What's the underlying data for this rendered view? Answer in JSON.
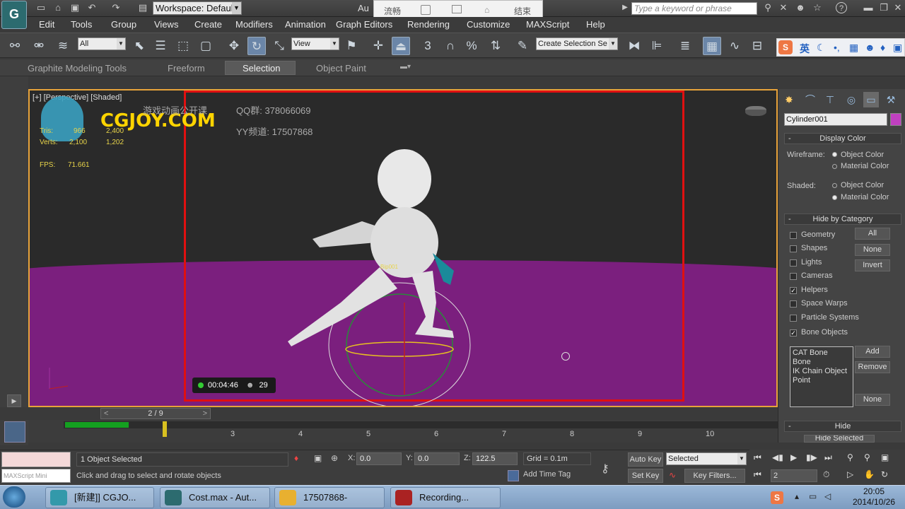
{
  "titlebar": {
    "workspace_label": "Workspace: Default",
    "app_title": "Au",
    "overlay_items": [
      "流畅",
      "结束"
    ],
    "search_placeholder": "Type a keyword or phrase"
  },
  "menu": [
    "Edit",
    "Tools",
    "Group",
    "Views",
    "Create",
    "Modifiers",
    "Animation",
    "Graph Editors",
    "Rendering",
    "Customize",
    "MAXScript",
    "Help"
  ],
  "toolbar": {
    "filter_select": "All",
    "refcoord_select": "View",
    "selection_set": "Create Selection Se",
    "snap_labels": [
      "3",
      "%"
    ]
  },
  "ime": {
    "lang": "英"
  },
  "ribbon": {
    "tabs": [
      "Graphite Modeling Tools",
      "Freeform",
      "Selection",
      "Object Paint"
    ]
  },
  "viewport": {
    "label": "[+] [Perspective] [Shaded]",
    "stats": {
      "tris_label": "Tris:",
      "tris_total": "966",
      "tris_sel": "2,400",
      "verts_label": "Verts:",
      "verts_total": "2,100",
      "verts_sel": "1,202",
      "fps_label": "FPS:",
      "fps": "71.661"
    },
    "watermark": {
      "brand": "CGJOY.COM",
      "subtitle": "游戏动画公开课",
      "qq": "QQ群:  378066069",
      "yy": "YY频道: 17507868"
    },
    "timer": {
      "time": "00:04:46",
      "viewers": "29"
    }
  },
  "cmdpanel": {
    "object_name": "Cylinder001",
    "object_color": "#c040c0",
    "display_color": {
      "title": "Display Color",
      "wireframe_label": "Wireframe:",
      "shaded_label": "Shaded:",
      "opt_object": "Object Color",
      "opt_material": "Material Color"
    },
    "hide_by_category": {
      "title": "Hide by Category",
      "items": [
        {
          "label": "Geometry",
          "checked": false
        },
        {
          "label": "Shapes",
          "checked": false
        },
        {
          "label": "Lights",
          "checked": false
        },
        {
          "label": "Cameras",
          "checked": false
        },
        {
          "label": "Helpers",
          "checked": true
        },
        {
          "label": "Space Warps",
          "checked": false
        },
        {
          "label": "Particle Systems",
          "checked": false
        },
        {
          "label": "Bone Objects",
          "checked": true
        }
      ],
      "btn_all": "All",
      "btn_none": "None",
      "btn_invert": "Invert",
      "list": [
        "CAT Bone",
        "Bone",
        "IK Chain Object",
        "Point"
      ],
      "btn_add": "Add",
      "btn_remove": "Remove",
      "btn_none2": "None"
    },
    "hide": {
      "title": "Hide",
      "first_item": "Hide Selected"
    }
  },
  "timeline": {
    "frame_display": "2 / 9",
    "ticks": [
      "3",
      "4",
      "5",
      "6",
      "7",
      "8",
      "9",
      "10"
    ]
  },
  "status": {
    "selected": "1 Object Selected",
    "prompt": "Click and drag to select and rotate objects",
    "x": "0.0",
    "y": "0.0",
    "z": "122.5",
    "grid": "Grid = 0.1m",
    "add_time_tag": "Add Time Tag",
    "auto_key": "Auto Key",
    "set_key": "Set Key",
    "key_mode": "Selected",
    "key_filters": "Key Filters...",
    "frame": "2",
    "maxscript_placeholder": "MAXScript Mini"
  },
  "taskbar": {
    "tasks": [
      "[新建]] CGJO...",
      "Cost.max - Aut...",
      "17507868-",
      "Recording..."
    ],
    "time": "20:05",
    "date": "2014/10/26"
  }
}
